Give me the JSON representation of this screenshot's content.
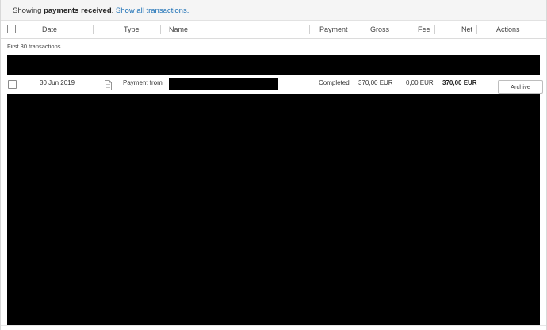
{
  "status": {
    "prefix": "Showing ",
    "strong": "payments received",
    "suffix": ". ",
    "link": "Show all transactions."
  },
  "table": {
    "columns": [
      "Date",
      "Type",
      "Name",
      "Payment",
      "Gross",
      "Fee",
      "Net",
      "Actions"
    ],
    "group_label": "First 30 transactions",
    "rows": [
      {
        "date": "30 Jun 2019",
        "type": "Payment from",
        "type_icon": "document-icon",
        "name": "",
        "payment": "Completed",
        "gross": "370,00 EUR",
        "fee": "0,00 EUR",
        "net": "370,00 EUR",
        "action": "Archive"
      }
    ]
  },
  "colors": {
    "link": "#1a6fb5",
    "redaction": "#000000",
    "status_bar_bg": "#f5f5f5"
  }
}
